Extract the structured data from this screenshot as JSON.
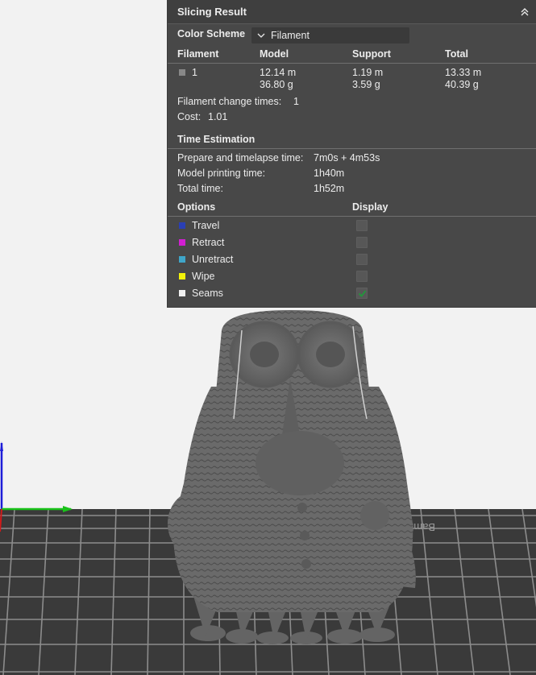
{
  "panel": {
    "title": "Slicing Result",
    "color_scheme_label": "Color Scheme",
    "color_scheme_value": "Filament",
    "headers": {
      "filament": "Filament",
      "model": "Model",
      "support": "Support",
      "total": "Total"
    },
    "filament_row": {
      "id": "1",
      "model_length": "12.14 m",
      "model_weight": "36.80 g",
      "support_length": "1.19 m",
      "support_weight": "3.59 g",
      "total_length": "13.33 m",
      "total_weight": "40.39 g",
      "swatch_color": "#888888"
    },
    "filament_change_label": "Filament change times:",
    "filament_change_value": "1",
    "cost_label": "Cost:",
    "cost_value": "1.01",
    "time_estimation_title": "Time Estimation",
    "times": [
      {
        "label": "Prepare and timelapse time:",
        "value": "7m0s + 4m53s"
      },
      {
        "label": "Model printing time:",
        "value": "1h40m"
      },
      {
        "label": "Total time:",
        "value": "1h52m"
      }
    ],
    "options_header": "Options",
    "display_header": "Display",
    "options": [
      {
        "label": "Travel",
        "color": "#2a3fb5",
        "checked": false
      },
      {
        "label": "Retract",
        "color": "#d21fd2",
        "checked": false
      },
      {
        "label": "Unretract",
        "color": "#3fa6c9",
        "checked": false
      },
      {
        "label": "Wipe",
        "color": "#f2f20a",
        "checked": false
      },
      {
        "label": "Seams",
        "color": "#f0f0f0",
        "checked": true
      }
    ]
  },
  "scene": {
    "plate_text": "Bambu Textu",
    "model_color": "#6b6b6b"
  }
}
